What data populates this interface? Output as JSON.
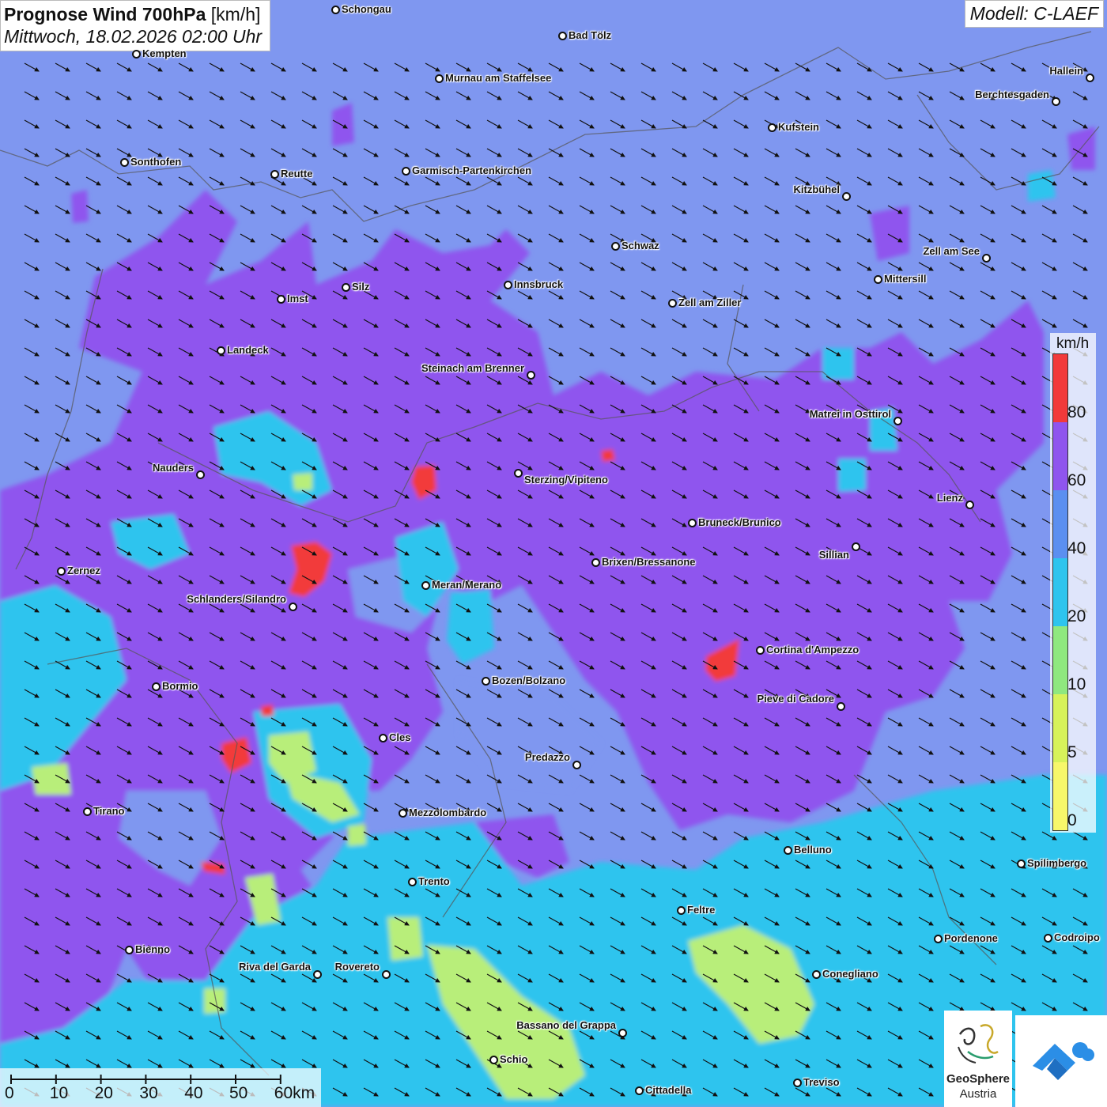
{
  "header": {
    "title": "Prognose Wind 700hPa",
    "unit": "[km/h]",
    "datetime": "Mittwoch, 18.02.2026 02:00 Uhr"
  },
  "model_label": "Modell: C-LAEF",
  "legend": {
    "unit": "km/h",
    "labels": [
      "80",
      "60",
      "40",
      "20",
      "10",
      "5",
      "0"
    ],
    "colors": [
      "#f23a3a",
      "#8f55ee",
      "#5b8ff0",
      "#2ec4ee",
      "#8fe87f",
      "#d7f25a",
      "#f7f76a"
    ]
  },
  "field_colors": {
    "background": "#7f97f0",
    "strong": "#8f55ee",
    "weak": "#2ec4ee",
    "calm": "#b8ee7a",
    "extreme": "#f23a3a"
  },
  "wind_direction": "north-west to south-east",
  "scale": {
    "ticks": [
      "0",
      "10",
      "20",
      "30",
      "40",
      "50",
      "60km"
    ]
  },
  "branding": {
    "logo_name": "GeoSphere",
    "logo_sub": "Austria"
  },
  "cities": [
    {
      "name": "Schongau"
    },
    {
      "name": "Bad Tölz"
    },
    {
      "name": "Kempten"
    },
    {
      "name": "Murnau am Staffelsee"
    },
    {
      "name": "Hallein"
    },
    {
      "name": "Berchtesgaden"
    },
    {
      "name": "Kufstein"
    },
    {
      "name": "Sonthofen"
    },
    {
      "name": "Reutte"
    },
    {
      "name": "Garmisch-Partenkirchen"
    },
    {
      "name": "Kitzbühel"
    },
    {
      "name": "Schwaz"
    },
    {
      "name": "Zell am See"
    },
    {
      "name": "Innsbruck"
    },
    {
      "name": "Mittersill"
    },
    {
      "name": "Silz"
    },
    {
      "name": "Imst"
    },
    {
      "name": "Zell am Ziller"
    },
    {
      "name": "Landeck"
    },
    {
      "name": "Steinach am Brenner"
    },
    {
      "name": "Matrei in Osttirol"
    },
    {
      "name": "Nauders"
    },
    {
      "name": "Sterzing/Vipiteno"
    },
    {
      "name": "Lienz"
    },
    {
      "name": "Bruneck/Brunico"
    },
    {
      "name": "Sillian"
    },
    {
      "name": "Zernez"
    },
    {
      "name": "Brixen/Bressanone"
    },
    {
      "name": "Meran/Merano"
    },
    {
      "name": "Schlanders/Silandro"
    },
    {
      "name": "Cortina d'Ampezzo"
    },
    {
      "name": "Bozen/Bolzano"
    },
    {
      "name": "Bormio"
    },
    {
      "name": "Pieve di Cadore"
    },
    {
      "name": "Cles"
    },
    {
      "name": "Predazzo"
    },
    {
      "name": "Tirano"
    },
    {
      "name": "Mezzolombardo"
    },
    {
      "name": "Belluno"
    },
    {
      "name": "Spilimbergo"
    },
    {
      "name": "Trento"
    },
    {
      "name": "Feltre"
    },
    {
      "name": "Bienno"
    },
    {
      "name": "Pordenone"
    },
    {
      "name": "Codroipo"
    },
    {
      "name": "Riva del Garda"
    },
    {
      "name": "Rovereto"
    },
    {
      "name": "Conegliano"
    },
    {
      "name": "Bassano del Grappa"
    },
    {
      "name": "Schio"
    },
    {
      "name": "Treviso"
    },
    {
      "name": "Cittadella"
    }
  ]
}
